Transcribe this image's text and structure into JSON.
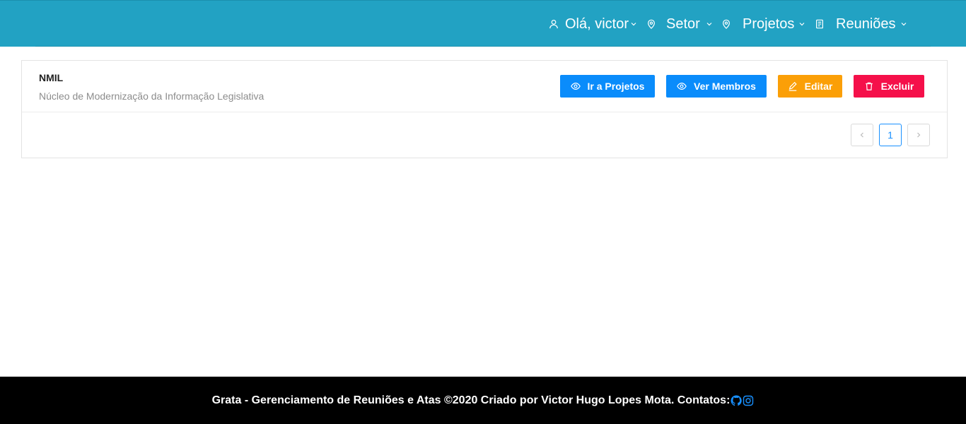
{
  "header": {
    "background": "#22a2c3",
    "nav": [
      {
        "icon": "user-icon",
        "label": "Olá, victor"
      },
      {
        "icon": "location-icon",
        "label": "Setor"
      },
      {
        "icon": "location-icon",
        "label": "Projetos"
      },
      {
        "icon": "document-icon",
        "label": "Reuniões"
      }
    ]
  },
  "sector": {
    "name": "NMIL",
    "description": "Núcleo de Modernização da Informação Legislativa",
    "actions": {
      "go_projects": "Ir a Projetos",
      "view_members": "Ver Membros",
      "edit": "Editar",
      "delete": "Excluir"
    }
  },
  "pagination": {
    "current_page": "1"
  },
  "footer": {
    "text": "Grata - Gerenciamento de Reuniões e Atas ©2020 Criado por Victor Hugo Lopes Mota. Contatos:",
    "icons": [
      "github-icon",
      "instagram-icon"
    ]
  },
  "colors": {
    "primary_blue": "#0a8cfb",
    "orange": "#fb9f07",
    "red": "#f5104a",
    "footer_bg": "#000000"
  }
}
